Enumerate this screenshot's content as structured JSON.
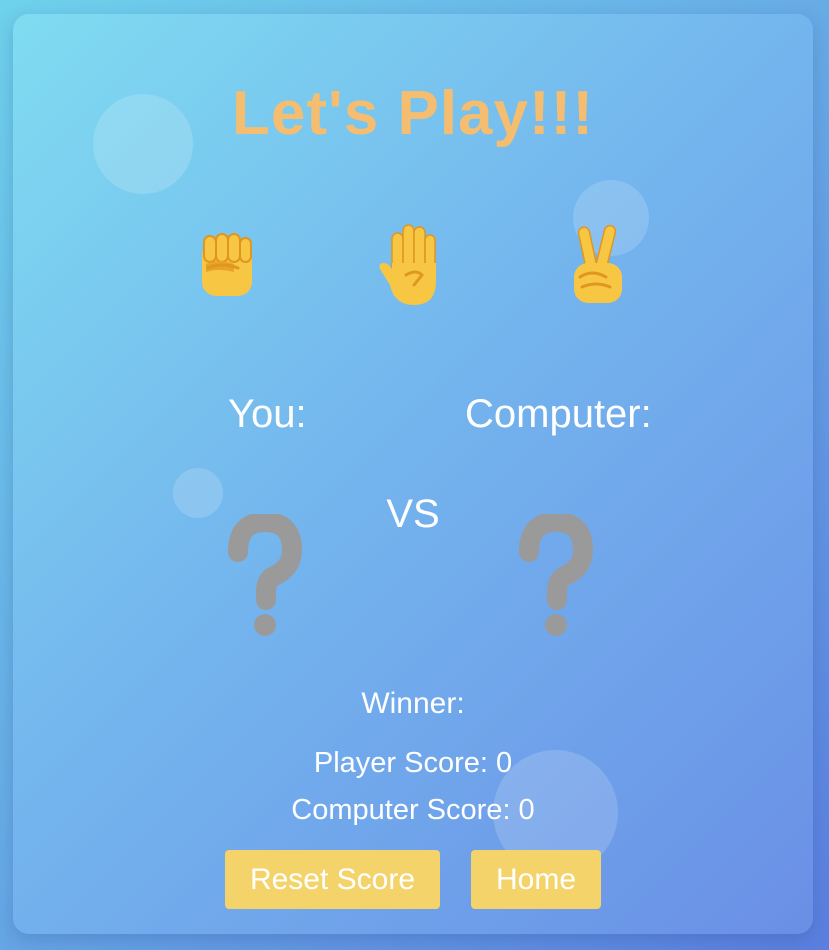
{
  "game": {
    "title": "Let's Play!!!",
    "choices": [
      {
        "icon": "rock-fist-icon"
      },
      {
        "icon": "paper-hand-icon"
      },
      {
        "icon": "scissors-victory-icon"
      }
    ],
    "player_label": "You:",
    "computer_label": "Computer:",
    "vs_label": "VS",
    "player_pick_icon": "question-mark-icon",
    "computer_pick_icon": "question-mark-icon",
    "winner_label": "Winner:",
    "player_score_label": "Player Score: 0",
    "computer_score_label": "Computer Score: 0",
    "reset_button": "Reset Score",
    "home_button": "Home"
  },
  "colors": {
    "title": "#f4bd6f",
    "button": "#f5d36b",
    "emoji_yellow": "#f7c643",
    "emoji_shade": "#e0961f",
    "question_mark": "#9a9a9a"
  }
}
